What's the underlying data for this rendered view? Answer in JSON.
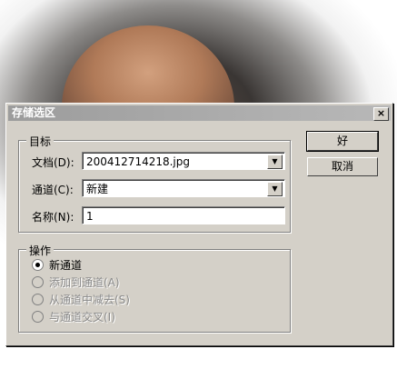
{
  "dialog": {
    "title": "存储选区",
    "close_label": "×",
    "buttons": {
      "ok": "好",
      "cancel": "取消"
    },
    "target": {
      "legend": "目标",
      "document_label": "文档(D):",
      "document_value": "200412714218.jpg",
      "channel_label": "通道(C):",
      "channel_value": "新建",
      "name_label": "名称(N):",
      "name_value": "1"
    },
    "operation": {
      "legend": "操作",
      "options": [
        {
          "label": "新通道",
          "selected": true,
          "enabled": true
        },
        {
          "label": "添加到通道(A)",
          "selected": false,
          "enabled": false
        },
        {
          "label": "从通道中减去(S)",
          "selected": false,
          "enabled": false
        },
        {
          "label": "与通道交叉(I)",
          "selected": false,
          "enabled": false
        }
      ]
    }
  }
}
